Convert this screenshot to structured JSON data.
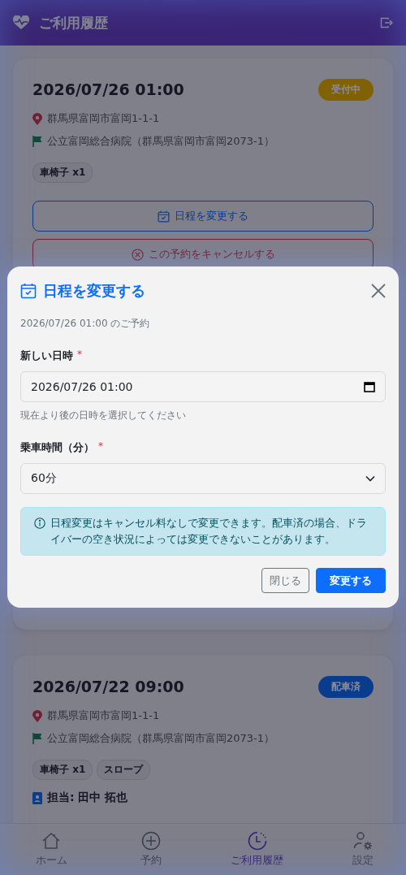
{
  "header": {
    "title": "ご利用履歴"
  },
  "bookings": [
    {
      "datetime": "2026/07/26 01:00",
      "status": "受付中",
      "color": "#806104",
      "pickup": "群馬県富岡市富岡1-1-1",
      "destination": "公立富岡総合病院（群馬県富岡市富岡2073-1）",
      "tags": [
        "車椅子 x1"
      ],
      "actions": [
        {
          "kind": "reschedule",
          "label": "日程を変更する"
        },
        {
          "kind": "cancel",
          "label": "この予約をキャンセルする"
        }
      ]
    },
    {
      "datetime": "2026/07/22 09:00",
      "status": "配車済",
      "color": "#0a3c8e",
      "pickup": "群馬県富岡市富岡1-1-1",
      "destination": "公立富岡総合病院（群馬県富岡市富岡2073-1）",
      "tags": [
        "車椅子 x1",
        "スロープ"
      ],
      "driver": "担当: 田中 拓也"
    }
  ],
  "dialog": {
    "title": "日程を変更する",
    "subtitle": "2026/07/26 01:00 のご予約",
    "fields": [
      {
        "kind": "datetime",
        "label": "新しい日時",
        "required_mark": "*",
        "value": "2026/07/26 01:00",
        "help": "現在より後の日時を選択してください"
      },
      {
        "kind": "select",
        "label": "乗車時間（分）",
        "required_mark": "*",
        "value": "60分"
      }
    ],
    "notice": "日程変更はキャンセル料なしで変更できます。配車済の場合、ドライバーの空き状況によっては変更できないことがあります。",
    "buttons": [
      {
        "kind": "secondary",
        "label": "閉じる"
      },
      {
        "kind": "primary",
        "label": "変更する"
      }
    ]
  },
  "nav": [
    {
      "kind": "home",
      "label": "ホーム",
      "selected": false
    },
    {
      "kind": "add",
      "label": "予約",
      "selected": false
    },
    {
      "kind": "history",
      "label": "ご利用履歴",
      "selected": true
    },
    {
      "kind": "settings",
      "label": "設定",
      "selected": false
    }
  ]
}
